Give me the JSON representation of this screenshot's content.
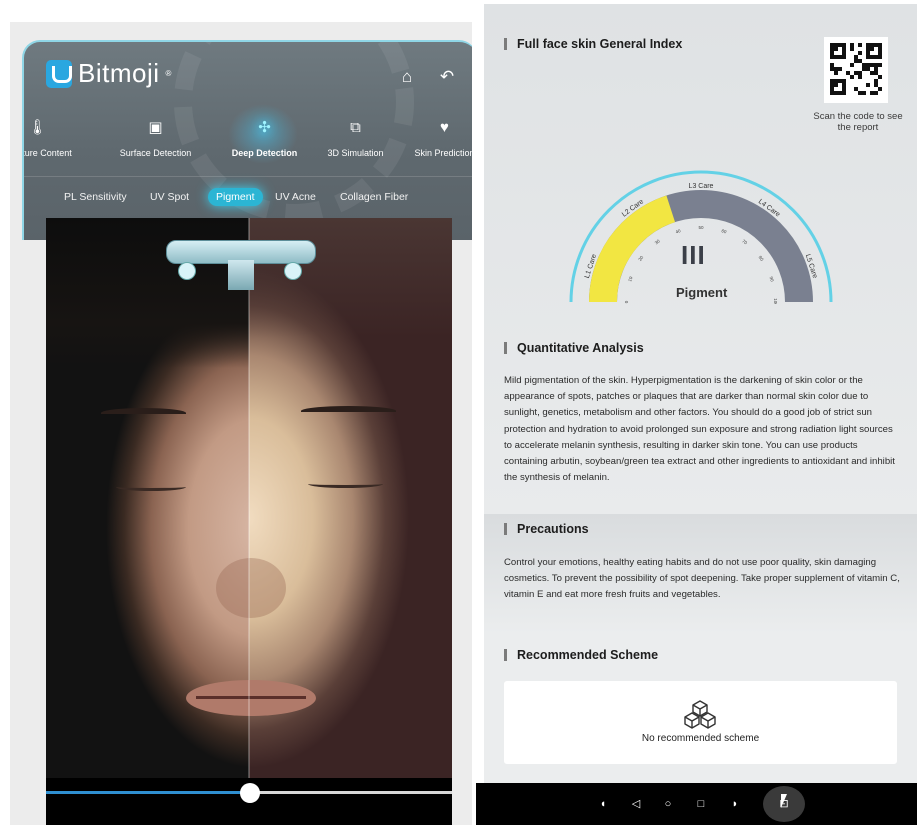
{
  "app": {
    "brand": "Bitmoji",
    "brand_mark": "®"
  },
  "header": {
    "home_icon": "home-icon",
    "back_icon": "back-arrow-icon"
  },
  "tabs": [
    {
      "label": "Moisture Content",
      "icon": "thermometer-icon"
    },
    {
      "label": "Surface Detection",
      "icon": "image-trend-icon"
    },
    {
      "label": "Deep Detection",
      "icon": "molecule-icon",
      "active": true
    },
    {
      "label": "3D Simulation",
      "icon": "3d-icon"
    },
    {
      "label": "Skin Prediction",
      "icon": "heartbeat-icon"
    }
  ],
  "subtabs": [
    {
      "label": "PL Sensitivity"
    },
    {
      "label": "UV Spot"
    },
    {
      "label": "Pigment",
      "active": true
    },
    {
      "label": "UV Acne"
    },
    {
      "label": "Collagen Fiber"
    }
  ],
  "comparison_slider": {
    "value": 0.5
  },
  "report": {
    "general_index": {
      "title": "Full face skin General Index",
      "qr_caption": "Scan the code to see the report",
      "gauge": {
        "value": "III",
        "name": "Pigment",
        "levels": [
          "L1 Care",
          "L2 Care",
          "L3 Care",
          "L4 Care",
          "L5 Care"
        ],
        "ticks": [
          "0",
          "10",
          "20",
          "30",
          "40",
          "50",
          "60",
          "70",
          "80",
          "90",
          "100"
        ],
        "fill_fraction": 0.4,
        "colors": {
          "fill": "#f2e642",
          "track": "#7a8090",
          "outer": "#63d1e6"
        }
      }
    },
    "quantitative": {
      "title": "Quantitative Analysis",
      "text": "Mild pigmentation of the skin. Hyperpigmentation is the darkening of skin color or the appearance of spots, patches or plaques that are darker than normal skin color due to sunlight, genetics, metabolism and other factors. You should do a good job of strict sun protection and hydration to avoid prolonged sun exposure and strong radiation light sources to accelerate melanin synthesis, resulting in darker skin tone. You can use products containing arbutin, soybean/green tea extract and other ingredients to antioxidant and inhibit the synthesis of melanin."
    },
    "precautions": {
      "title": "Precautions",
      "text": "Control your emotions, healthy eating habits and do not use poor quality, skin damaging cosmetics. To prevent the possibility of spot deepening. Take proper supplement of vitamin C, vitamin E and eat more fresh fruits and vegetables."
    },
    "recommended": {
      "title": "Recommended Scheme",
      "empty_text": "No recommended scheme",
      "empty_icon": "cubes-icon"
    }
  },
  "system_nav": {
    "items": [
      "volume-down-icon",
      "back-triangle-icon",
      "home-circle-icon",
      "recents-square-icon",
      "volume-up-icon",
      "screenshot-icon"
    ]
  }
}
